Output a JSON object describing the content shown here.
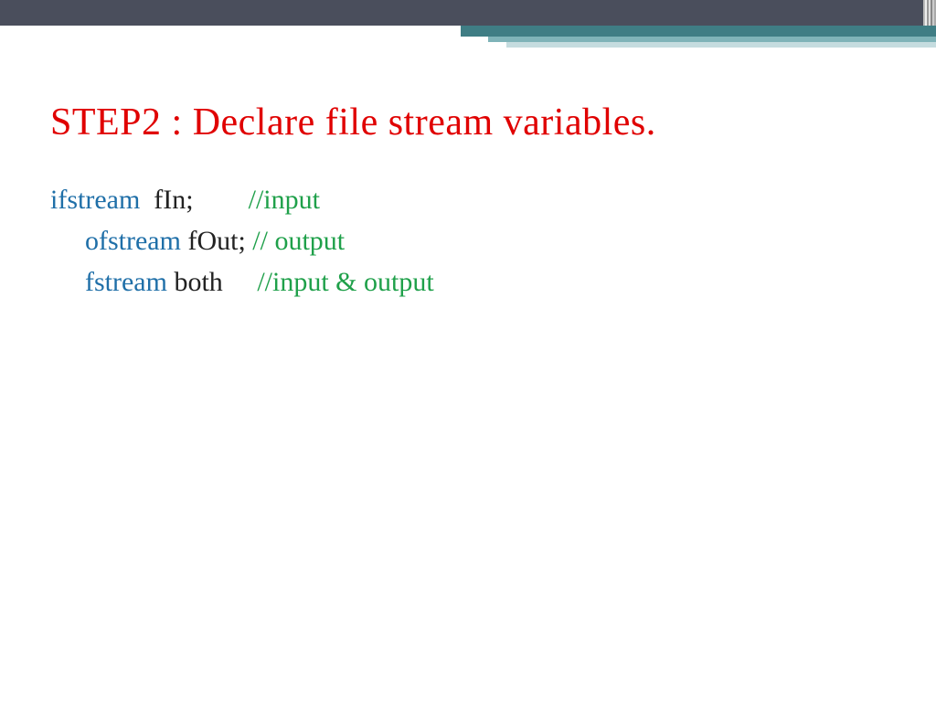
{
  "title": "STEP2 : Declare file stream variables.",
  "colors": {
    "title": "#e00000",
    "keyword": "#1f6fa8",
    "identifier": "#222222",
    "comment": "#1fa04a"
  },
  "code": {
    "lines": [
      {
        "indent": false,
        "keyword": "ifstream",
        "rest": "  fIn;        ",
        "comment": "//input"
      },
      {
        "indent": true,
        "keyword": "ofstream",
        "rest": " fOut; ",
        "comment": "// output"
      },
      {
        "indent": true,
        "keyword": "fstream",
        "rest": " both     ",
        "comment": "//input & output"
      }
    ]
  }
}
